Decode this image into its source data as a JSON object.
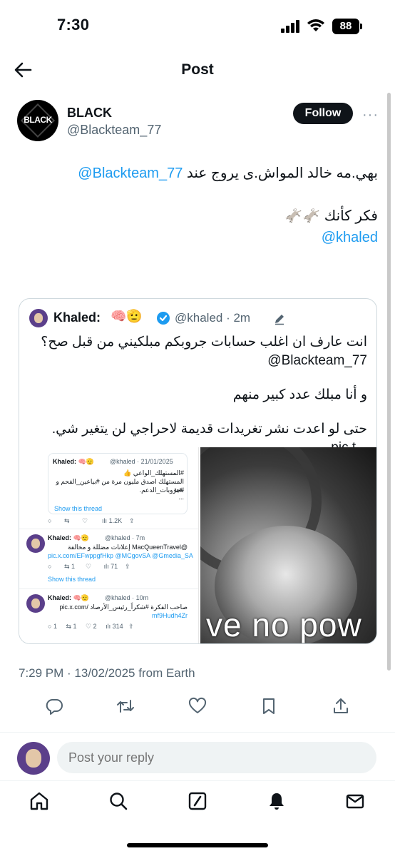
{
  "status_bar": {
    "time": "7:30",
    "battery": "88"
  },
  "header": {
    "title": "Post"
  },
  "author": {
    "avatar_text": "BLACK",
    "name": "BLACK",
    "handle": "@Blackteam_77",
    "follow_label": "Follow",
    "more": "···"
  },
  "post": {
    "line1_text": "بهي.مه خالد المواش.ى يروج عند ",
    "line1_mention": "@Blackteam_77",
    "line2_text": "فكر كأنك 🫏🫏",
    "line3_mention": "@khaled"
  },
  "quote": {
    "name": "Khaled:",
    "emojis": "🧠🫡",
    "handle": "@khaled · 2m",
    "text_line1": "انت عارف ان اغلب حسابات جروبكم مبلكيني من قبل صح؟",
    "text_line2": "@Blackteam_77",
    "text_line3": "و أنا مبلك عدد كبير منهم",
    "text_line4": "حتى لو اعدت نشر تغريدات قديمة لاحراجي لن يتغير شي. ...pic.t",
    "photo_caption": "ve no pow",
    "screenshot": {
      "card_name": "Khaled: 🧠🫡",
      "card_handle": "@khaled · 21/01/2025",
      "card_line1": "#المستهلك_الواعي 👍",
      "card_line2": "المستهلك اصدق مليون مرة من #بياعين_الفحم و بقية",
      "card_line3": "#جروبات_الدعم.",
      "card_more": "...",
      "show_thread": "Show this thread",
      "stat_views1": "1.2K",
      "t2_name": "Khaled: 🧠🫡",
      "t2_handle": "@khaled · 7m",
      "t2_line1": "@MacQueenTravel إعلانات مضللة و مخالفة",
      "t2_line2": "pic.x.com/EFwppgfHkp @MCgovSA @Gmedia_SA",
      "t2_stat_rt": "1",
      "t2_stat_views": "71",
      "show_thread2": "Show this thread",
      "t3_name": "Khaled: 🧠🫡",
      "t3_handle": "@khaled · 10m",
      "t3_line1": "صاحب الفكرة #شكراً_رئيس_الأرصاد /pic.x.com",
      "t3_line2": "mf9Hudh4Zr",
      "t3_stat_reply": "1",
      "t3_stat_rt": "1",
      "t3_stat_like": "2",
      "t3_stat_views": "314"
    }
  },
  "meta": {
    "timestamp": "7:29 PM · 13/02/2025 from Earth"
  },
  "reply": {
    "placeholder": "Post your reply"
  },
  "icons": {
    "back": "arrow-left-icon",
    "reply": "reply-icon",
    "repost": "repost-icon",
    "like": "heart-icon",
    "bookmark": "bookmark-icon",
    "share": "share-icon",
    "home": "home-icon",
    "search": "search-icon",
    "grok": "grok-icon",
    "notifications": "bell-icon",
    "messages": "mail-icon"
  },
  "colors": {
    "accent": "#1d9bf0",
    "text": "#0f1419",
    "muted": "#536471"
  }
}
